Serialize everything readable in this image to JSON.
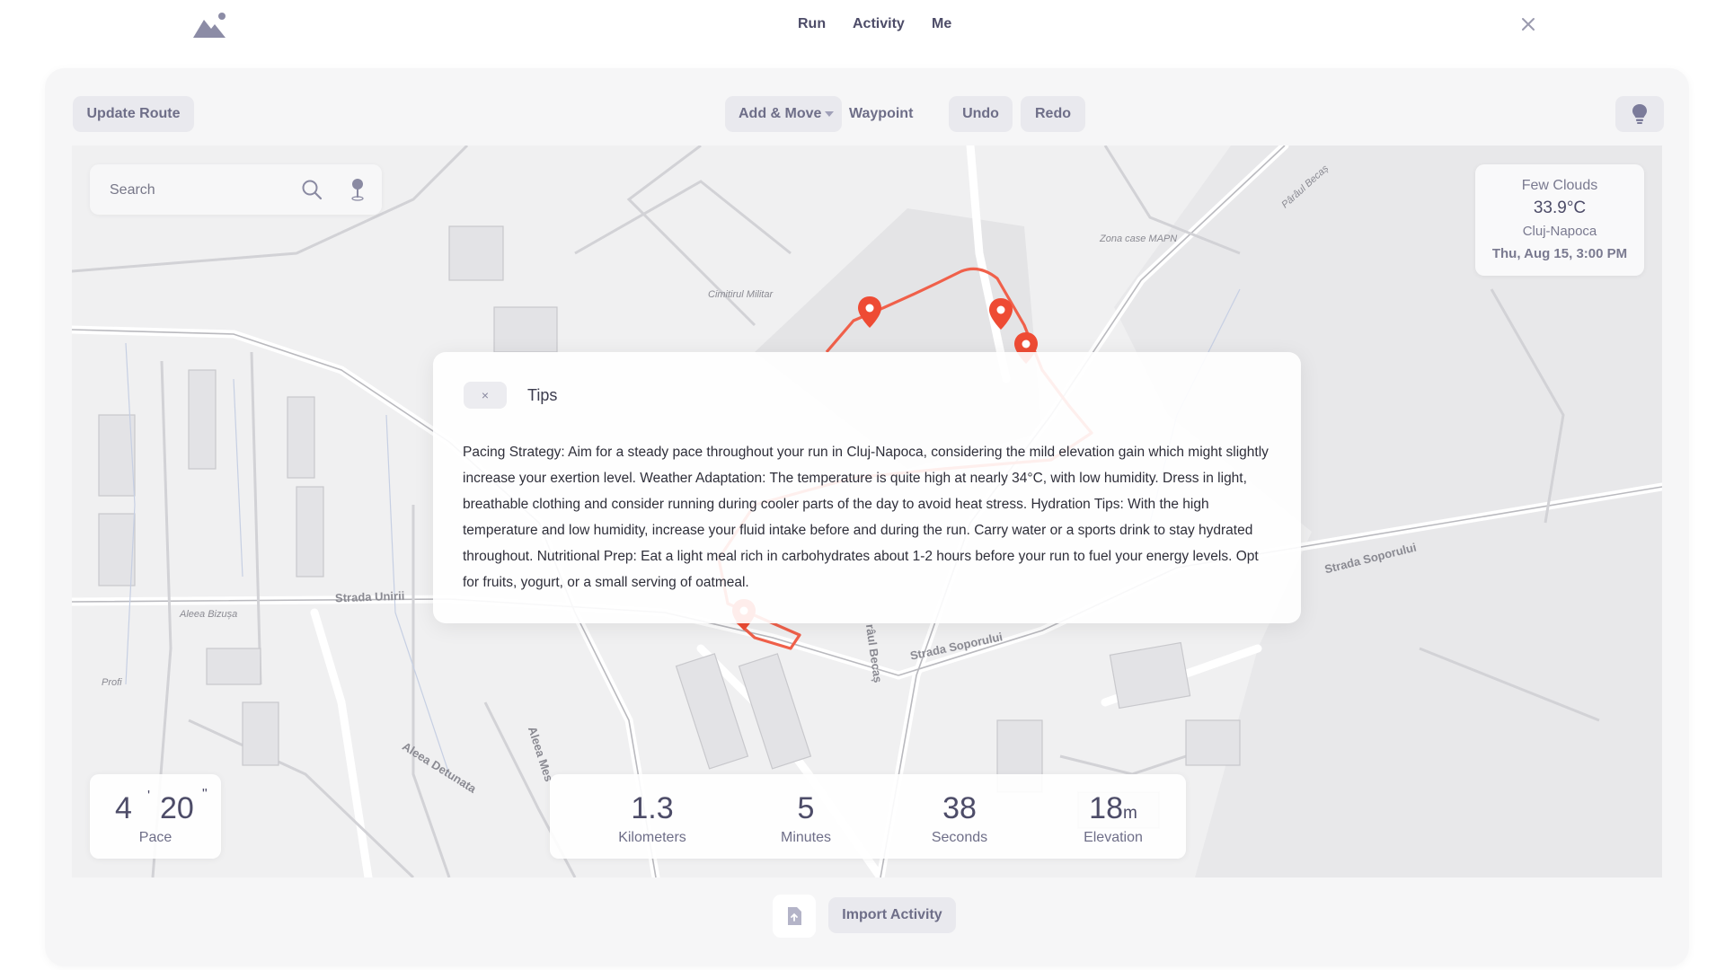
{
  "nav": {
    "run": "Run",
    "activity": "Activity",
    "me": "Me"
  },
  "toolbar": {
    "update_route": "Update Route",
    "mode": "Add & Move",
    "waypoint": "Waypoint",
    "undo": "Undo",
    "redo": "Redo"
  },
  "search": {
    "placeholder": "Search"
  },
  "weather": {
    "condition": "Few Clouds",
    "temperature": "33.9°C",
    "city": "Cluj-Napoca",
    "datetime": "Thu, Aug 15, 3:00 PM"
  },
  "map_labels": {
    "cimitirul": "Cimitirul Militar",
    "zona": "Zona case MAPN",
    "paraul": "Pârâul Becaș",
    "strada_unirii": "Strada Unirii",
    "aleea_bizusa": "Aleea Bizușa",
    "profi": "Profi",
    "aleea_detunata": "Aleea Detunata",
    "aleea_mesteacanului": "Aleea Mes",
    "strada_soporului": "Strada Soporului",
    "strada_soporului_2": "Strada Soporului",
    "paraul_becas_2": "râul Becaș"
  },
  "tips": {
    "title": "Tips",
    "close": "×",
    "body": "Pacing Strategy: Aim for a steady pace throughout your run in Cluj-Napoca, considering the mild elevation gain which might slightly increase your exertion level. Weather Adaptation: The temperature is quite high at nearly 34°C, with low humidity. Dress in light, breathable clothing and consider running during cooler parts of the day to avoid heat stress. Hydration Tips: With the high temperature and low humidity, increase your fluid intake before and during the run. Carry water or a sports drink to stay hydrated throughout. Nutritional Prep: Eat a light meal rich in carbohydrates about 1-2 hours before your run to fuel your energy levels. Opt for fruits, yogurt, or a small serving of oatmeal."
  },
  "pace": {
    "minutes": "4",
    "seconds": "20",
    "label": "Pace"
  },
  "stats": {
    "distance": {
      "value": "1.3",
      "label": "Kilometers"
    },
    "minutes": {
      "value": "5",
      "label": "Minutes"
    },
    "seconds": {
      "value": "38",
      "label": "Seconds"
    },
    "elevation": {
      "value": "18",
      "unit": "m",
      "label": "Elevation"
    }
  },
  "bottom": {
    "import": "Import Activity"
  },
  "icons": {
    "logo": "mountain-icon",
    "close": "close-icon",
    "search": "search-icon",
    "location": "location-pin-icon",
    "tips": "lightbulb-icon",
    "file": "file-upload-icon",
    "marker": "map-marker-icon"
  },
  "colors": {
    "route": "#f0604a",
    "marker": "#ee4b34",
    "accent": "#6e6e88"
  }
}
